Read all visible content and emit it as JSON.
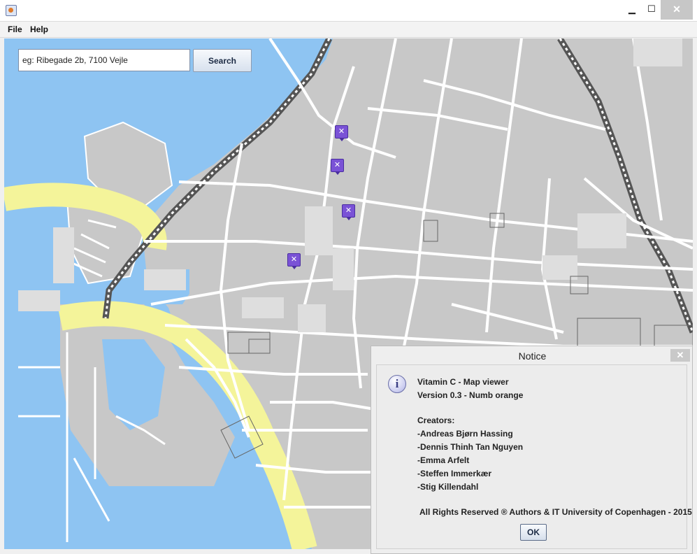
{
  "window": {
    "title": "",
    "controls": {
      "minimize": "▁",
      "maximize": "☐",
      "close": "✕"
    }
  },
  "menu": {
    "file": "File",
    "help": "Help"
  },
  "search": {
    "placeholder": "eg: Ribegade 2b, 7100 Vejle",
    "button_label": "Search"
  },
  "map": {
    "colors": {
      "water": "#8ec4f2",
      "land": "#c8c8c8",
      "road": "#ffffff",
      "highway": "#f4f49a",
      "building": "#dedede",
      "railway": "#555555"
    },
    "poi_icon": "restaurant-icon"
  },
  "dialog": {
    "title": "Notice",
    "close_label": "✕",
    "icon": "info-icon",
    "icon_glyph": "i",
    "lines": [
      "Vitamin C - Map viewer",
      "Version 0.3 - Numb orange",
      "",
      "Creators:",
      "-Andreas Bjørn Hassing",
      "-Dennis Thinh Tan Nguyen",
      "-Emma Arfelt",
      "-Steffen Immerkær",
      "-Stig Killendahl"
    ],
    "footer": "All Rights Reserved ® Authors & IT University of Copenhagen - 2015",
    "ok_label": "OK"
  }
}
